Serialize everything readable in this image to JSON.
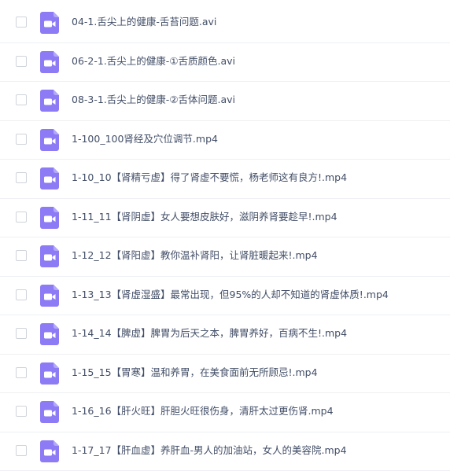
{
  "colors": {
    "icon_purple": "#8d7bf5",
    "icon_fold": "#b3a8f9",
    "text": "#424e67",
    "divider": "#eef0f3",
    "checkbox_border": "#cfd3da"
  },
  "files": [
    {
      "name": "04-1.舌尖上的健康-舌苔问题.avi",
      "icon": "video-file-icon"
    },
    {
      "name": "06-2-1.舌尖上的健康-①舌质颜色.avi",
      "icon": "video-file-icon"
    },
    {
      "name": "08-3-1.舌尖上的健康-②舌体问题.avi",
      "icon": "video-file-icon"
    },
    {
      "name": "1-100_100肾经及穴位调节.mp4",
      "icon": "video-file-icon"
    },
    {
      "name": "1-10_10【肾精亏虚】得了肾虚不要慌，杨老师这有良方!.mp4",
      "icon": "video-file-icon"
    },
    {
      "name": "1-11_11【肾阴虚】女人要想皮肤好，滋阴养肾要趁早!.mp4",
      "icon": "video-file-icon"
    },
    {
      "name": "1-12_12【肾阳虚】教你温补肾阳，让肾脏暖起来!.mp4",
      "icon": "video-file-icon"
    },
    {
      "name": "1-13_13【肾虚湿盛】最常出现，但95%的人却不知道的肾虚体质!.mp4",
      "icon": "video-file-icon"
    },
    {
      "name": "1-14_14【脾虚】脾胃为后天之本，脾胃养好，百病不生!.mp4",
      "icon": "video-file-icon"
    },
    {
      "name": "1-15_15【胃寒】温和养胃，在美食面前无所顾忌!.mp4",
      "icon": "video-file-icon"
    },
    {
      "name": "1-16_16【肝火旺】肝胆火旺很伤身，清肝太过更伤肾.mp4",
      "icon": "video-file-icon"
    },
    {
      "name": "1-17_17【肝血虚】养肝血-男人的加油站，女人的美容院.mp4",
      "icon": "video-file-icon"
    }
  ]
}
